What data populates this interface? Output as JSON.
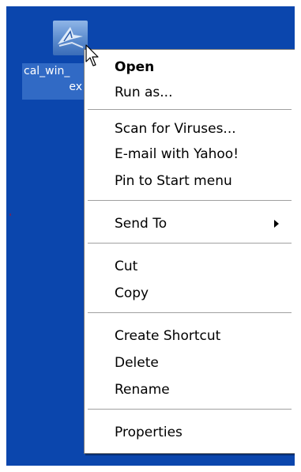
{
  "desktop": {
    "background": "#0b46ad",
    "icon": {
      "label_line1": "cal_win_",
      "label_line2": "ex",
      "icon_name": "application-icon"
    }
  },
  "context_menu": {
    "open": "Open",
    "run_as": "Run as...",
    "scan_viruses": "Scan for Viruses...",
    "email_yahoo": "E-mail with Yahoo!",
    "pin_start": "Pin to Start menu",
    "send_to": "Send To",
    "cut": "Cut",
    "copy": "Copy",
    "create_shortcut": "Create Shortcut",
    "delete": "Delete",
    "rename": "Rename",
    "properties": "Properties"
  },
  "cursor": {
    "icon_name": "arrow-cursor-icon"
  }
}
